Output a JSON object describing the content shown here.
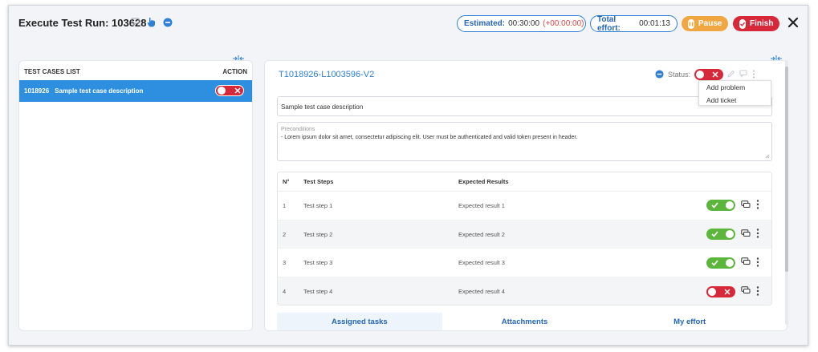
{
  "header": {
    "title": "Execute Test Run: 103628",
    "estimated_label": "Estimated:",
    "estimated_value": "00:30:00",
    "estimated_delta": "(+00:00:00)",
    "effort_label": "Total effort:",
    "effort_value": "00:01:13",
    "pause_label": "Pause",
    "finish_label": "Finish"
  },
  "left_panel": {
    "list_header": "TEST CASES LIST",
    "action_header": "ACTION",
    "items": [
      {
        "id": "1018926",
        "description": "Sample test case description",
        "status": "failed"
      }
    ]
  },
  "test_case": {
    "code": "T1018926-L1003596-V2",
    "status_label": "Status:",
    "description": "Sample test case description",
    "preconditions_label": "Preconditions",
    "preconditions_text": "- Lorem ipsum dolor sit amet, consectetur adipiscing elit. User must be authenticated and valid token present in header."
  },
  "context_menu": {
    "items": [
      "Add problem",
      "Add ticket"
    ]
  },
  "steps_table": {
    "headers": {
      "no": "N°",
      "steps": "Test Steps",
      "expected": "Expected Results"
    },
    "rows": [
      {
        "no": "1",
        "step": "Test step 1",
        "expected": "Expected result 1",
        "status": "passed"
      },
      {
        "no": "2",
        "step": "Test step 2",
        "expected": "Expected result 2",
        "status": "passed"
      },
      {
        "no": "3",
        "step": "Test step 3",
        "expected": "Expected result 3",
        "status": "passed"
      },
      {
        "no": "4",
        "step": "Test step 4",
        "expected": "Expected result 4",
        "status": "failed"
      }
    ]
  },
  "tabs": [
    {
      "label": "Assigned tasks",
      "active": true
    },
    {
      "label": "Attachments",
      "active": false
    },
    {
      "label": "My effort",
      "active": false
    }
  ],
  "colors": {
    "accent_blue": "#2f7fd6",
    "pause": "#f0a742",
    "finish": "#d7283a",
    "passed": "#5cb63c",
    "failed": "#d7283a"
  }
}
